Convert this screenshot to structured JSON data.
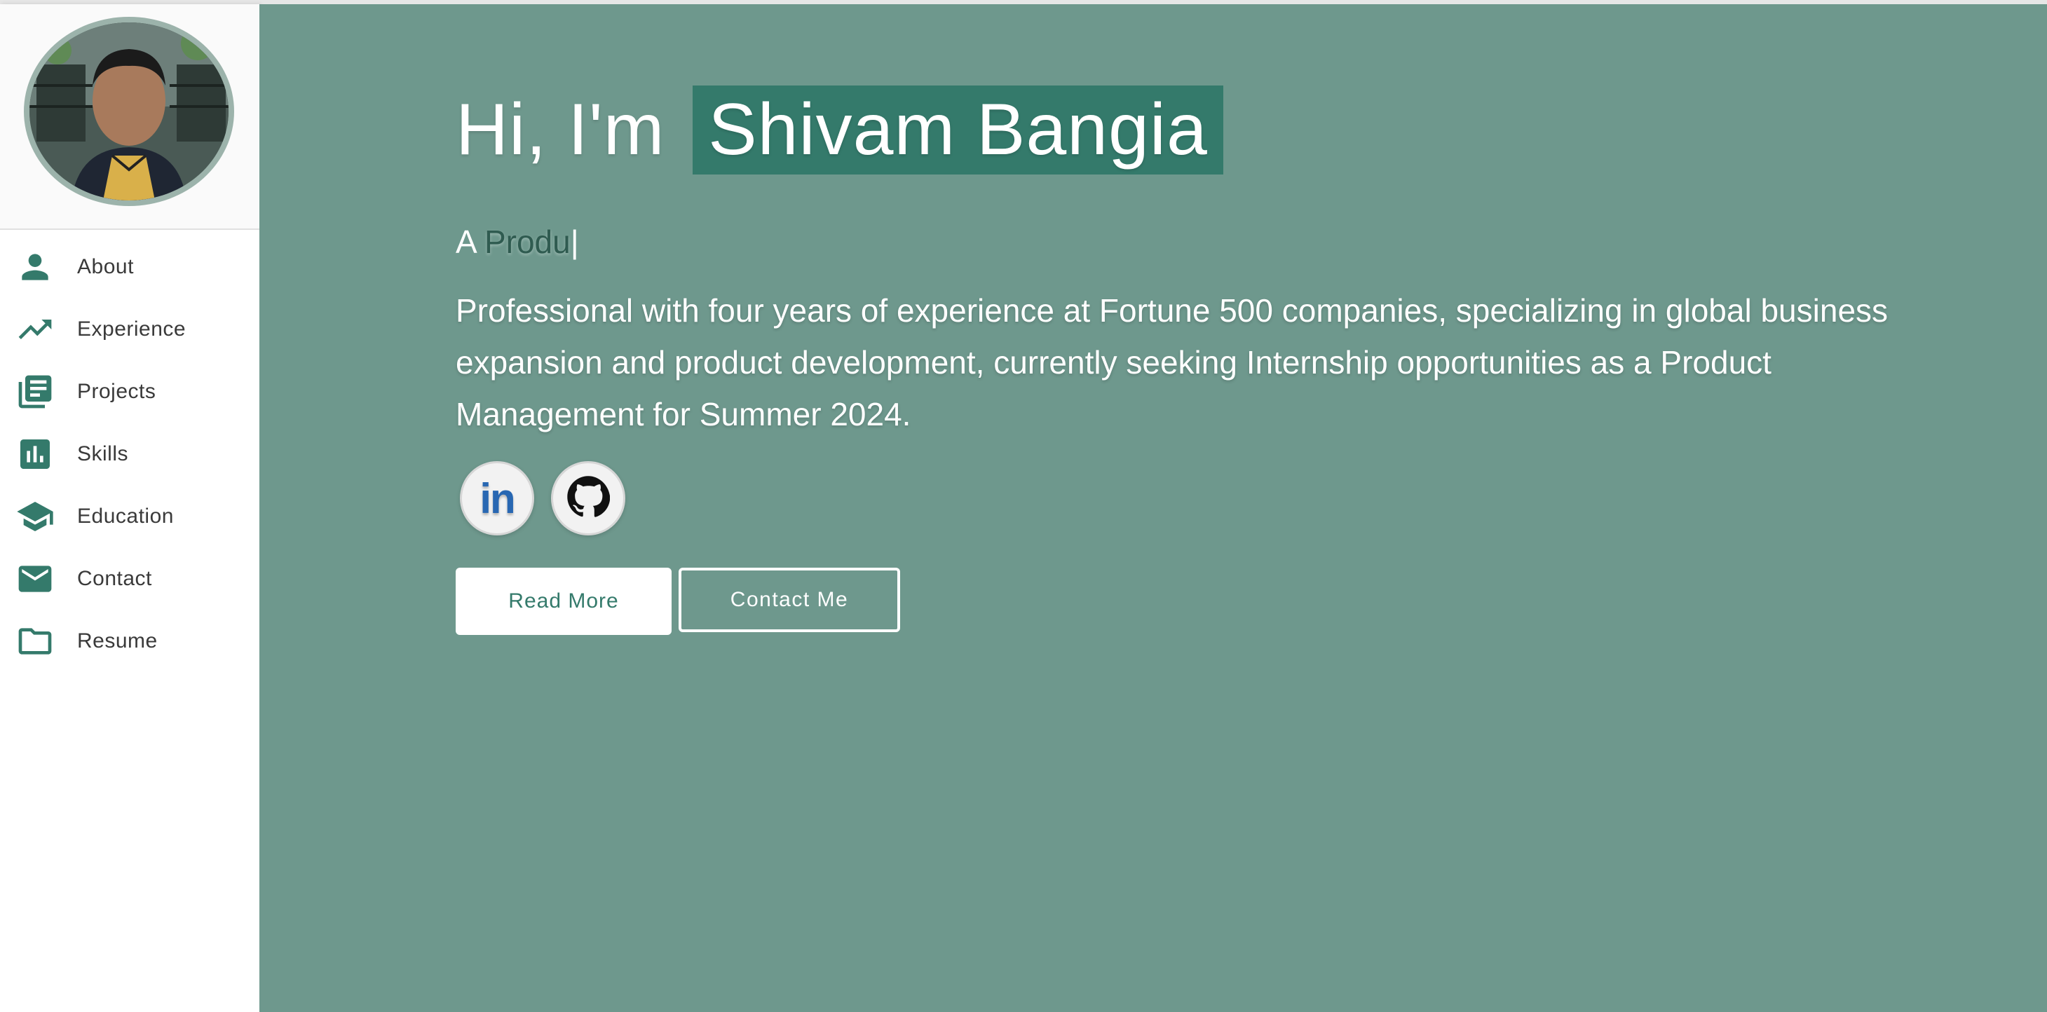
{
  "sidebar": {
    "items": [
      {
        "label": "About",
        "icon": "person-icon"
      },
      {
        "label": "Experience",
        "icon": "trending-up-icon"
      },
      {
        "label": "Projects",
        "icon": "library-books-icon"
      },
      {
        "label": "Skills",
        "icon": "bar-chart-icon"
      },
      {
        "label": "Education",
        "icon": "graduation-cap-icon"
      },
      {
        "label": "Contact",
        "icon": "mail-icon"
      },
      {
        "label": "Resume",
        "icon": "folder-icon"
      }
    ]
  },
  "hero": {
    "greeting": "Hi, I'm",
    "name": "Shivam Bangia",
    "typed_prefix": "A",
    "typed_word": "Produ",
    "cursor": "|",
    "description": "Professional with four years of experience at Fortune 500 companies, specializing in global business expansion and product development, currently seeking Internship opportunities as a Product Management for Summer 2024.",
    "social": [
      {
        "name": "linkedin-icon",
        "text": "in"
      },
      {
        "name": "github-icon"
      }
    ],
    "read_more_label": "Read More",
    "contact_label": "Contact Me"
  },
  "colors": {
    "accent": "#347a6b",
    "hero_background": "#6e988d",
    "icon_color": "#347a6b",
    "linkedin_blue": "#2867b2"
  }
}
